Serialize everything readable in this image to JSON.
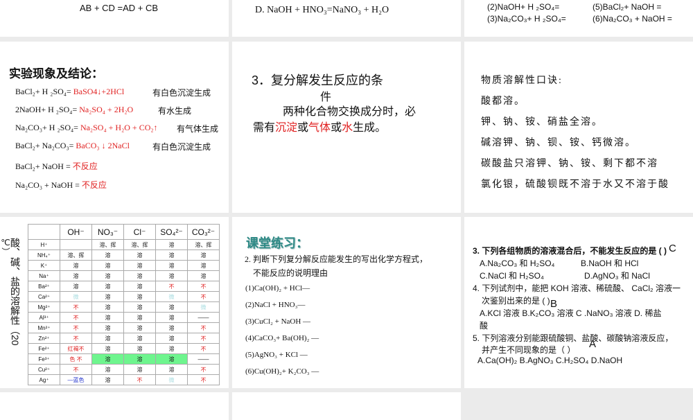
{
  "slides": {
    "s1": {
      "text": "AB + CD  =AD + CB"
    },
    "s2": {
      "text": "D. NaOH  +  HNO₃=NaNO₃  +  H₂O"
    },
    "s3": {
      "l1a": "(2)NaOH+ H ₂SO₄=",
      "l1b": "(5)BaCl₂+ NaOH =",
      "l2a": "(3)Na₂CO₃+ H ₂SO₄=",
      "l2b": "(6)Na₂CO₃ + NaOH ="
    },
    "s4": {
      "title": "实验现象及结论：",
      "lines": [
        {
          "lhs": "BaCl₂+ H ₂SO₄= ",
          "rhs": "BaSO4↓+2HCl",
          "note": "有白色沉淀生成"
        },
        {
          "lhs": "2NaOH+ H ₂SO₄= ",
          "rhs": "Na₂SO₄  +  2H₂O",
          "note": "有水生成"
        },
        {
          "lhs": "Na₂CO₃+ H ₂SO₄= ",
          "rhs": "Na₂SO₄  +  H₂O  +  CO₂↑",
          "note": "有气体生成"
        },
        {
          "lhs": "BaCl₂+ Na₂CO₃= ",
          "rhs": "BaCO₃ ↓ 2NaCl",
          "note": "有白色沉淀生成"
        },
        {
          "lhs": "BaCl₂+ NaOH = ",
          "rhs": "不反应",
          "note": ""
        },
        {
          "lhs": "Na₂CO₃  +  NaOH = ",
          "rhs": "不反应",
          "note": ""
        }
      ]
    },
    "s5": {
      "title1": "3．复分解发生反应的条",
      "title2": "件",
      "body1": "两种化合物交换成分时，必",
      "body2a": "需有",
      "w1": "沉淀",
      "or1": "或",
      "w2": "气体",
      "or2": "或",
      "w3": "水",
      "body2b": "生成。"
    },
    "s6": {
      "lines": [
        "物质溶解性口诀:",
        "酸都溶。",
        "钾、钠、铵、硝盐全溶。",
        "碱溶钾、钠、钡、铵、钙微溶。",
        "碳酸盐只溶钾、钠、铵、剩下都不溶",
        "氯化银，硫酸钡既不溶于水又不溶于酸"
      ]
    },
    "s7": {
      "side_main": "酸、碱、盐的溶解性（20",
      "side_end": "℃）",
      "headers": [
        "",
        "OH⁻",
        "NO₃⁻",
        "Cl⁻",
        "SO₄²⁻",
        "CO₃²⁻"
      ],
      "rows": [
        [
          "H⁺",
          "",
          "溶、挥",
          "溶、挥",
          "溶",
          "溶、挥"
        ],
        [
          "NH₄⁺",
          "溶、挥",
          "溶",
          "溶",
          "溶",
          "溶"
        ],
        [
          "K⁺",
          "溶",
          "溶",
          "溶",
          "溶",
          "溶"
        ],
        [
          "Na⁺",
          "溶",
          "溶",
          "溶",
          "溶",
          "溶"
        ],
        [
          "Ba²⁺",
          "溶",
          "溶",
          "溶",
          "不",
          "不"
        ],
        [
          "Ca²⁺",
          "微",
          "溶",
          "溶",
          "微",
          "不"
        ],
        [
          "Mg²⁺",
          "不",
          "溶",
          "溶",
          "溶",
          "微"
        ],
        [
          "Al³⁺",
          "不",
          "溶",
          "溶",
          "溶",
          "——"
        ],
        [
          "Mn²⁺",
          "不",
          "溶",
          "溶",
          "溶",
          "不"
        ],
        [
          "Zn²⁺",
          "不",
          "溶",
          "溶",
          "溶",
          "不"
        ],
        [
          "Fe²⁺",
          "红褐不",
          "溶",
          "溶",
          "溶",
          "不"
        ],
        [
          "Fe³⁺",
          "色 不",
          "溶",
          "溶",
          "溶",
          "——"
        ],
        [
          "Cu²⁺",
          "不",
          "溶",
          "溶",
          "溶",
          "不"
        ],
        [
          "Ag⁺",
          "—蓝色",
          "溶",
          "不",
          "微",
          "不"
        ]
      ]
    },
    "s8": {
      "title": "课堂练习：",
      "q1": "2. 判断下列复分解反应能发生的写出化学方程式，",
      "q2": "不能反应的说明理由",
      "items": [
        "(1)Ca(OH)₂ + HCl—",
        "(2)NaCl  + HNO₃—",
        "(3)CuCl₂  + NaOH —",
        "(4)CaCO₃+ Ba(OH)₂ —",
        "(5)AgNO₃  + KCl —",
        "(6)Cu(OH)₂+ K₂CO₃ —"
      ]
    },
    "s9": {
      "q3": "3. 下列各组物质的溶液混合后，不能发生反应的是 (   )",
      "a3": "C",
      "q3a": "A.Na₂CO₃ 和 H₂SO₄",
      "q3b": "B.NaOH 和 HCl",
      "q3c": "C.NaCl 和 H₂SO₄",
      "q3d": "D.AgNO₃ 和 NaCl",
      "q4": "4. 下列试剂中，能把 KOH 溶液、稀硫酸、 CaCl₂ 溶液一",
      "q4b": "次鉴别出来的是 (      )",
      "a4": "B",
      "q4opts": "A.KCl 溶液    B.K₂CO₃ 溶液  C .NaNO₃ 溶液    D. 稀盐",
      "q4end": "酸",
      "q5": "5. 下列溶液分别能跟硫酸铜、盐酸、碳酸钠溶液反应，",
      "q5b": "并产生不同现象的是（        ）",
      "a5": "A",
      "q5opts": "A.Ca(OH)₂   B.AgNO₃   C.H₂SO₄   D.NaOH"
    }
  }
}
